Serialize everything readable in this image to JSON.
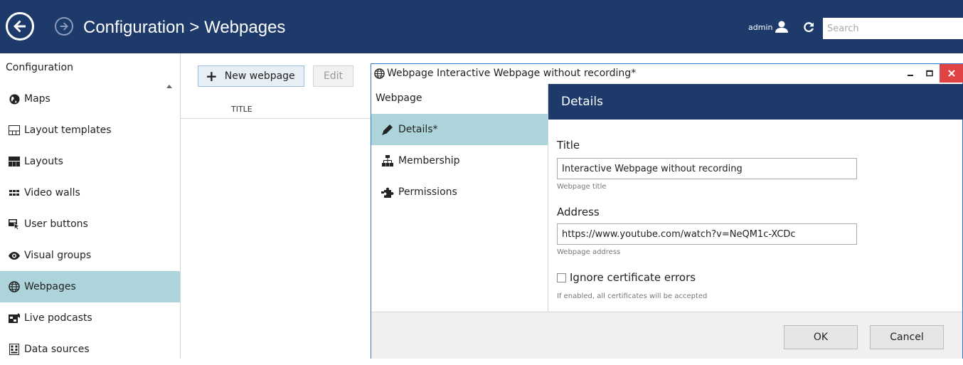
{
  "header": {
    "title": "Configuration > Webpages",
    "user": "admin",
    "search_placeholder": "Search"
  },
  "sidebar": {
    "heading": "Configuration",
    "items": [
      {
        "label": "Maps",
        "icon": "globe-icon"
      },
      {
        "label": "Layout templates",
        "icon": "layout-template-icon"
      },
      {
        "label": "Layouts",
        "icon": "layouts-icon"
      },
      {
        "label": "Video walls",
        "icon": "video-wall-icon"
      },
      {
        "label": "User buttons",
        "icon": "user-button-icon"
      },
      {
        "label": "Visual groups",
        "icon": "eye-icon"
      },
      {
        "label": "Webpages",
        "icon": "webpage-globe-icon",
        "active": true
      },
      {
        "label": "Live podcasts",
        "icon": "podcast-icon"
      },
      {
        "label": "Data sources",
        "icon": "data-source-icon"
      }
    ]
  },
  "list": {
    "new_button": "New webpage",
    "edit_button": "Edit",
    "column_title": "TITLE"
  },
  "dialog": {
    "title": "Webpage Interactive Webpage without recording*",
    "left_heading": "Webpage",
    "nav": [
      {
        "label": "Details*",
        "icon": "pencil-icon",
        "active": true
      },
      {
        "label": "Membership",
        "icon": "hierarchy-icon"
      },
      {
        "label": "Permissions",
        "icon": "puzzle-icon"
      }
    ],
    "details_header": "Details",
    "title_label": "Title",
    "title_value": "Interactive Webpage without recording",
    "title_hint": "Webpage title",
    "address_label": "Address",
    "address_value": "https://www.youtube.com/watch?v=NeQM1c-XCDc",
    "address_hint": "Webpage address",
    "ignore_cert_label": "Ignore certificate errors",
    "ignore_cert_hint": "If enabled, all certificates will be accepted",
    "ignore_cert_checked": false,
    "ok_button": "OK",
    "cancel_button": "Cancel"
  },
  "colors": {
    "header_bg": "#1d3a6b",
    "active_item_bg": "#add4db",
    "close_button_bg": "#e04343"
  }
}
